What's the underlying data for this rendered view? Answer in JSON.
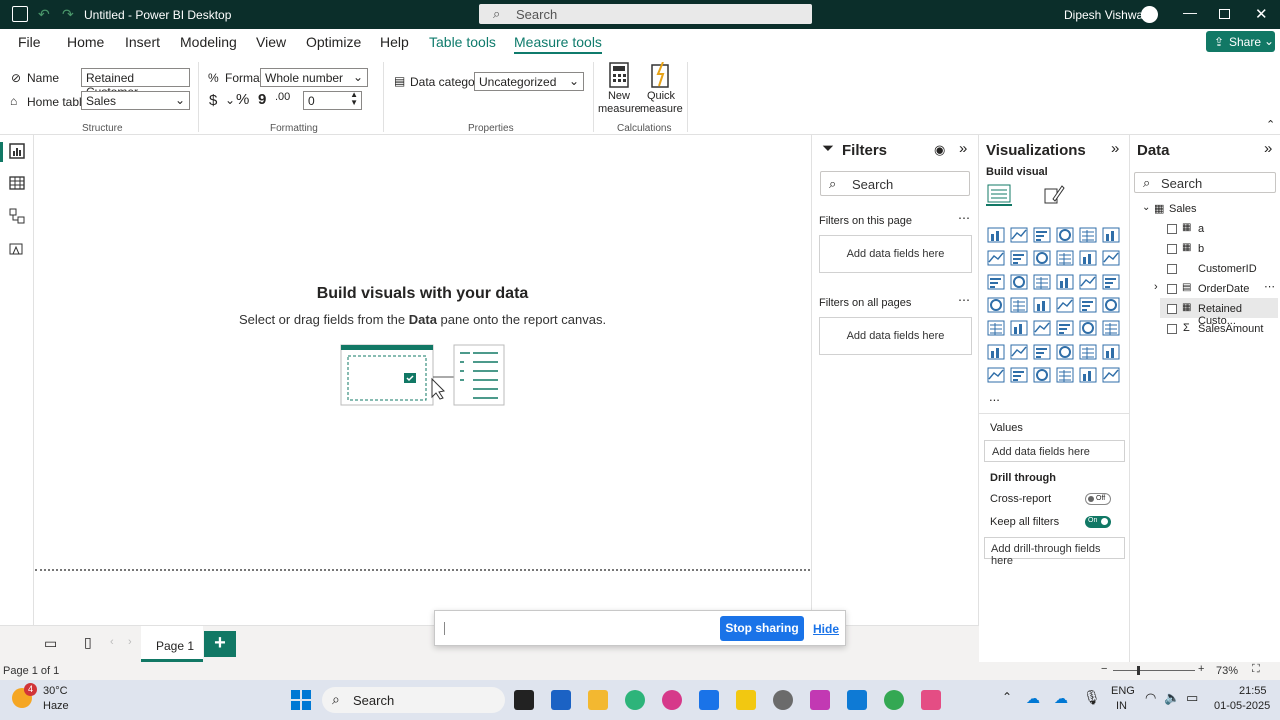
{
  "titlebar": {
    "title": "Untitled - Power BI Desktop",
    "search": "Search",
    "user": "Dipesh Vishwas"
  },
  "tabs": [
    "File",
    "Home",
    "Insert",
    "Modeling",
    "View",
    "Optimize",
    "Help",
    "Table tools",
    "Measure tools"
  ],
  "share_label": "Share",
  "structure": {
    "name_label": "Name",
    "name_value": "Retained Customer",
    "home_table_label": "Home table",
    "home_table_value": "Sales",
    "group": "Structure"
  },
  "formatting": {
    "format_label": "Format",
    "format_value": "Whole number",
    "currency": "$",
    "comma": "ˇ",
    "percent": "%",
    "decimals_value": "0",
    "group": "Formatting"
  },
  "properties": {
    "data_category_label": "Data category",
    "data_category_value": "Uncategorized",
    "group": "Properties"
  },
  "calculations": {
    "new_measure": "New measure",
    "quick_measure": "Quick measure",
    "group": "Calculations"
  },
  "canvas": {
    "heading": "Build visuals with your data",
    "sub_pre": "Select or drag fields from the ",
    "sub_bold": "Data",
    "sub_post": " pane onto the report canvas."
  },
  "filters": {
    "title": "Filters",
    "search": "Search",
    "on_page": "Filters on this page",
    "on_all": "Filters on all pages",
    "add": "Add data fields here"
  },
  "viz": {
    "title": "Visualizations",
    "build": "Build visual",
    "values": "Values",
    "values_add": "Add data fields here",
    "drill": "Drill through",
    "cross": "Cross-report",
    "cross_state": "Off",
    "keep": "Keep all filters",
    "keep_state": "On",
    "drill_add": "Add drill-through fields here",
    "more": "..."
  },
  "data": {
    "title": "Data",
    "search": "Search",
    "table": "Sales",
    "fields": [
      "a",
      "b",
      "CustomerID",
      "OrderDate",
      "Retained Custo...",
      "SalesAmount"
    ]
  },
  "pages": {
    "page1": "Page 1",
    "status": "Page 1 of 1",
    "zoom": "73%"
  },
  "sharebar": {
    "stop": "Stop sharing",
    "hide": "Hide"
  },
  "taskbar": {
    "temp": "30°C",
    "weather": "Haze",
    "search": "Search",
    "lang1": "ENG",
    "lang2": "IN",
    "time": "21:55",
    "date": "01-05-2025",
    "badge": "4"
  }
}
